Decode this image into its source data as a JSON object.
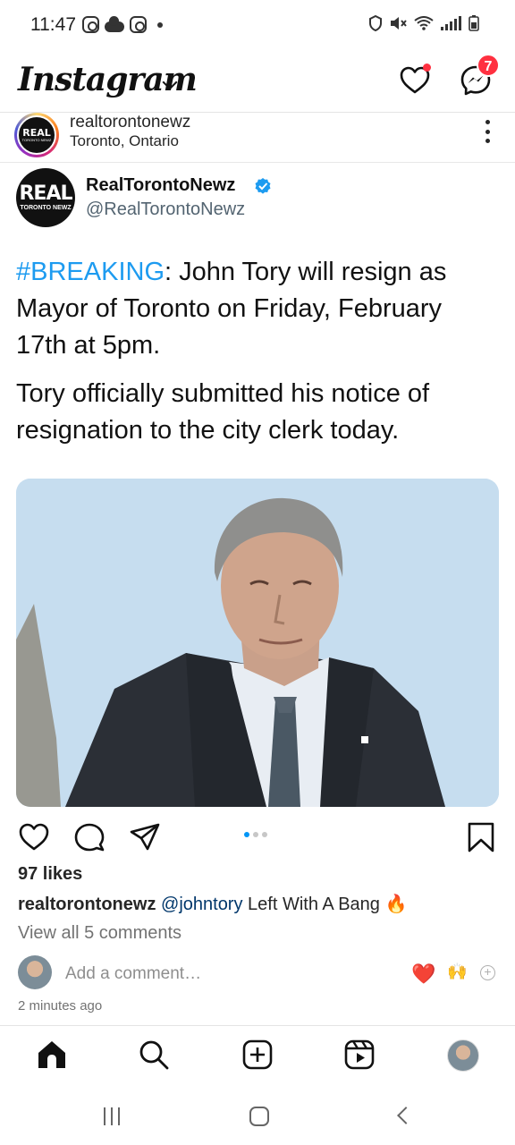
{
  "status_bar": {
    "time": "11:47",
    "left_icons": [
      "instagram-icon",
      "cloud-icon",
      "instagram-icon",
      "dot-icon"
    ],
    "right_icons": [
      "shield-icon",
      "mute-icon",
      "wifi-icon",
      "signal-icon",
      "battery-icon"
    ]
  },
  "header": {
    "logo": "Instagram",
    "notification_count": "7",
    "colors": {
      "badge": "#ff3040"
    }
  },
  "post": {
    "username": "realtorontonewz",
    "location": "Toronto, Ontario",
    "avatar_text": "REAL",
    "avatar_subtext": "TORONTO NEWZ"
  },
  "tweet": {
    "display_name": "RealTorontoNewz",
    "handle": "@RealTorontoNewz",
    "avatar_text": "REAL",
    "avatar_subtext": "TORONTO NEWZ",
    "hashtag": "#BREAKING",
    "text1": ": John Tory will resign as Mayor of Toronto on Friday, February 17th at 5pm.",
    "text2": "Tory officially submitted his notice of resignation to the city clerk today.",
    "colors": {
      "hashtag": "#1d9bf0",
      "verified": "#1d9bf0"
    }
  },
  "photo": {
    "carousel_count": 3,
    "carousel_active": 1
  },
  "engagement": {
    "likes": "97 likes",
    "caption_user": "realtorontonewz",
    "caption_mention": "@johntory",
    "caption_text": " Left With A Bang 🔥",
    "view_comments": "View all 5 comments",
    "add_comment_placeholder": "Add a comment…",
    "quick_reactions": [
      "❤️",
      "🙌"
    ],
    "time_ago": "2 minutes ago"
  },
  "bottom_nav": [
    "home-icon",
    "search-icon",
    "create-icon",
    "reels-icon",
    "profile-avatar"
  ]
}
